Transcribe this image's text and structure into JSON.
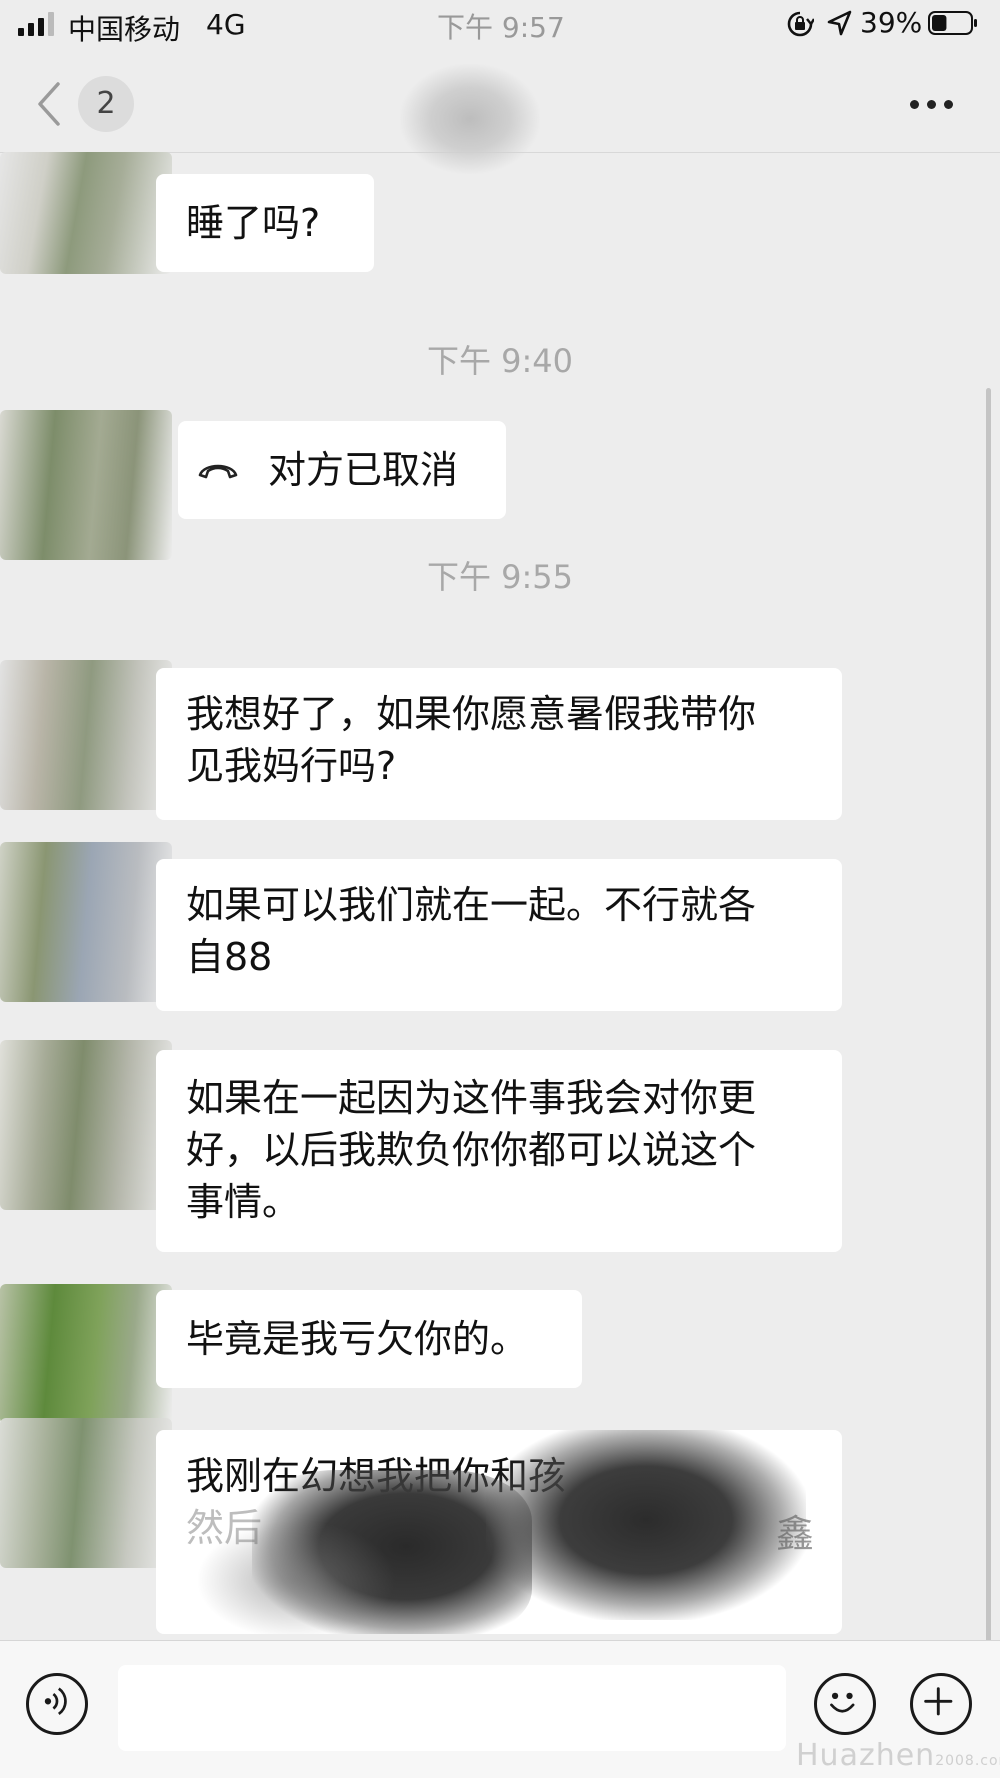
{
  "status_bar": {
    "carrier": "中国移动",
    "network": "4G",
    "time": "下午 9:57",
    "battery_percent": "39%",
    "battery_level": 0.39,
    "signal_bars": 3
  },
  "nav": {
    "back_icon": "chevron-left-icon",
    "unread_count": "2",
    "more_icon": "ellipsis-icon"
  },
  "messages": [
    {
      "type": "text",
      "text": "睡了吗?"
    },
    {
      "type": "timestamp",
      "text": "下午 9:40"
    },
    {
      "type": "call",
      "icon": "phone-hangup-icon",
      "text": "对方已取消"
    },
    {
      "type": "timestamp",
      "text": "下午 9:55"
    },
    {
      "type": "text",
      "lines": [
        "我想好了，如果你愿意暑假我带你",
        "见我妈行吗?"
      ]
    },
    {
      "type": "text",
      "lines": [
        "如果可以我们就在一起。不行就各",
        "自88"
      ]
    },
    {
      "type": "text",
      "lines": [
        "如果在一起因为这件事我会对你更",
        "好，以后我欺负你你都可以说这个",
        "事情。"
      ]
    },
    {
      "type": "text",
      "text": "毕竟是我亏欠你的。"
    },
    {
      "type": "text",
      "lines": [
        "我刚在幻想我把你和孩",
        "然后",
        "鑫"
      ]
    }
  ],
  "input_bar": {
    "voice_icon": "voice-icon",
    "emoji_icon": "smiley-icon",
    "plus_icon": "plus-icon"
  },
  "watermark": {
    "main": "Huazhen",
    "sub": "2008.com"
  },
  "colors": {
    "background": "#ededed",
    "bubble": "#ffffff",
    "timestamp": "#a8a8a8",
    "input_bar": "#f7f7f7"
  }
}
